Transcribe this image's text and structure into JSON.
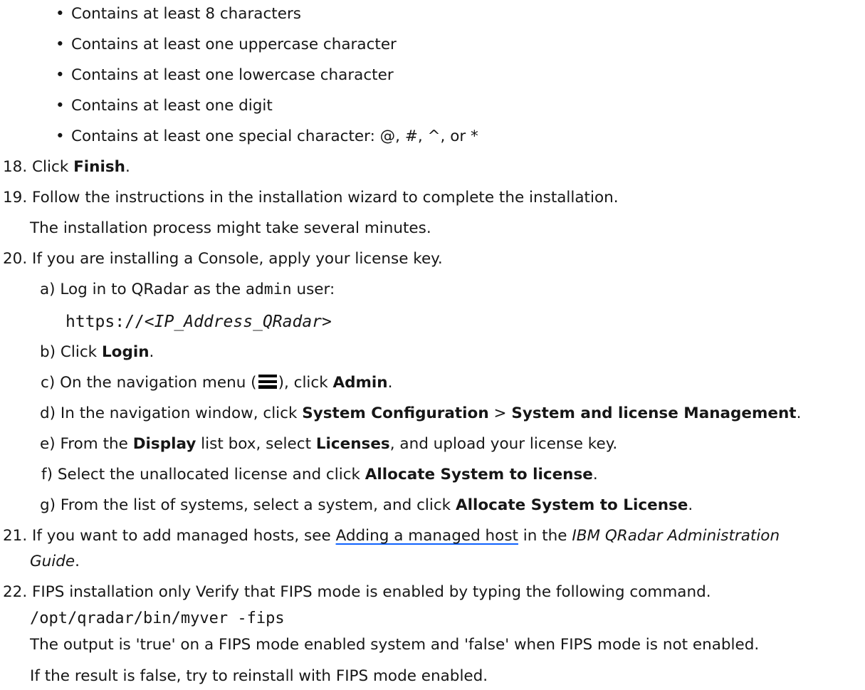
{
  "requirements": [
    "Contains at least 8 characters",
    "Contains at least one uppercase character",
    "Contains at least one lowercase character",
    "Contains at least one digit",
    "Contains at least one special character: @, #, ^, or *"
  ],
  "step18": {
    "num": "18.",
    "pre": "Click ",
    "bold": "Finish",
    "post": "."
  },
  "step19": {
    "num": "19.",
    "text": "Follow the instructions in the installation wizard to complete the installation.",
    "note": "The installation process might take several minutes."
  },
  "step20": {
    "num": "20.",
    "text": "If you are installing a Console, apply your license key.",
    "a": {
      "label": "a)",
      "pre": "Log in to QRadar as the ",
      "code": "admin",
      "post": " user:",
      "url_prefix": "https://",
      "url_var": "<IP_Address_QRadar>"
    },
    "b": {
      "label": "b)",
      "pre": "Click ",
      "bold": "Login",
      "post": "."
    },
    "c": {
      "label": "c)",
      "pre": "On the navigation menu (",
      "icon": "hamburger-menu-icon",
      "mid": "), click ",
      "bold": "Admin",
      "post": "."
    },
    "d": {
      "label": "d)",
      "pre": "In the navigation window, click ",
      "bold1": "System Configuration",
      "sep": " > ",
      "bold2": "System and license Management",
      "post": "."
    },
    "e": {
      "label": "e)",
      "pre": "From the ",
      "bold1": "Display",
      "mid": " list box, select ",
      "bold2": "Licenses",
      "post": ", and upload your license key."
    },
    "f": {
      "label": "f)",
      "pre": "Select the unallocated license and click ",
      "bold": "Allocate System to license",
      "post": "."
    },
    "g": {
      "label": "g)",
      "pre": "From the list of systems, select a system, and click ",
      "bold": "Allocate System to License",
      "post": "."
    }
  },
  "step21": {
    "num": "21.",
    "pre": "If you want to add managed hosts, see ",
    "link": "Adding a managed host",
    "mid": " in the ",
    "italic1": "IBM QRadar Administration",
    "italic2": "Guide",
    "post": "."
  },
  "step22": {
    "num": "22.",
    "text": "FIPS installation only Verify that FIPS mode is enabled by typing the following command.",
    "command": "/opt/qradar/bin/myver -fips",
    "output": "The output is 'true' on a FIPS mode enabled system and 'false' when FIPS mode is not enabled.",
    "note": "If the result is false, try to reinstall with FIPS mode enabled."
  }
}
